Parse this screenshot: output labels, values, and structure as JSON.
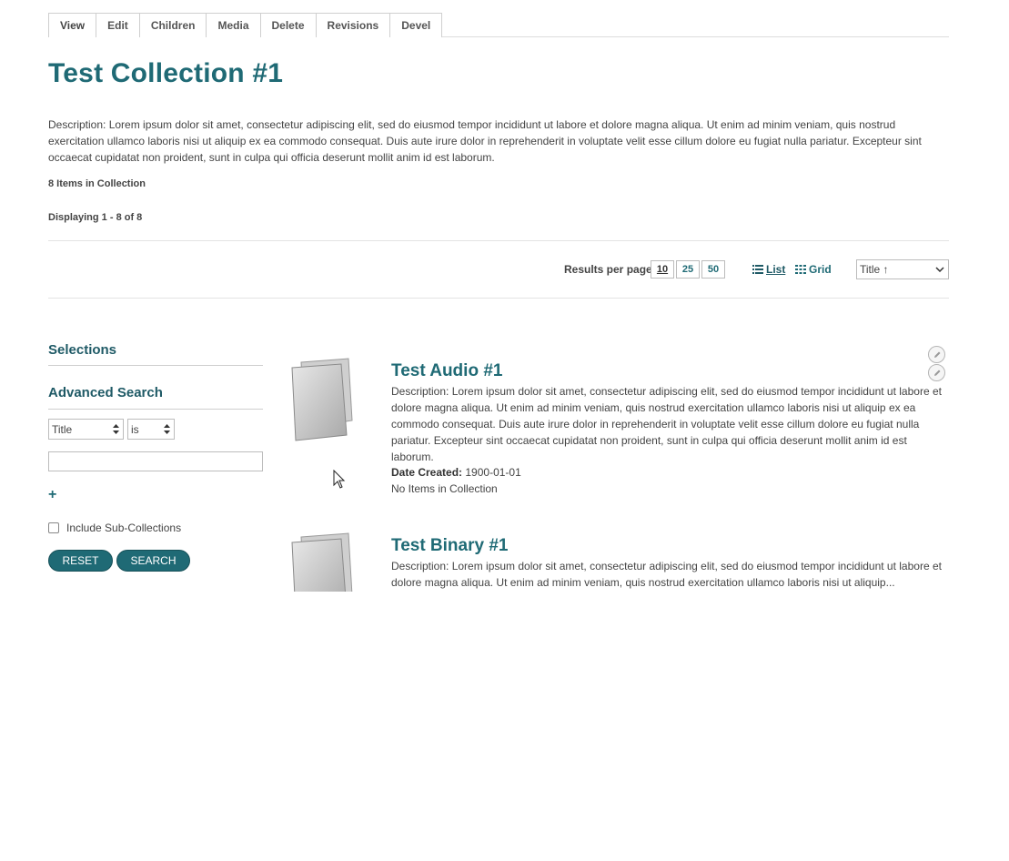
{
  "tabs": [
    {
      "label": "View"
    },
    {
      "label": "Edit"
    },
    {
      "label": "Children"
    },
    {
      "label": "Media"
    },
    {
      "label": "Delete"
    },
    {
      "label": "Revisions"
    },
    {
      "label": "Devel"
    }
  ],
  "collection": {
    "title": "Test Collection #1",
    "description": "Description: Lorem ipsum dolor sit amet, consectetur adipiscing elit, sed do eiusmod tempor incididunt ut labore et dolore magna aliqua. Ut enim ad minim veniam, quis nostrud exercitation ullamco laboris nisi ut aliquip ex ea commodo consequat. Duis aute irure dolor in reprehenderit in voluptate velit esse cillum dolore eu fugiat nulla pariatur. Excepteur sint occaecat cupidatat non proident, sunt in culpa qui officia deserunt mollit anim id est laborum.",
    "item_count": "8 Items in Collection",
    "displaying": "Displaying 1 - 8 of 8"
  },
  "toolbar": {
    "results_per_page_label": "Results per page",
    "rpp_options": [
      "10",
      "25",
      "50"
    ],
    "list_label": "List",
    "grid_label": "Grid",
    "sort_value": "Title ↑"
  },
  "sidebar": {
    "selections_heading": "Selections",
    "advanced_heading": "Advanced Search",
    "field_value": "Title",
    "operator_value": "is",
    "search_value": "",
    "plus_glyph": "+",
    "include_sub": "Include Sub-Collections",
    "reset_label": "Reset",
    "search_label": "Search"
  },
  "results": [
    {
      "title": "Test Audio #1",
      "description": "Description: Lorem ipsum dolor sit amet, consectetur adipiscing elit, sed do eiusmod tempor incididunt ut labore et dolore magna aliqua. Ut enim ad minim veniam, quis nostrud exercitation ullamco laboris nisi ut aliquip ex ea commodo consequat. Duis aute irure dolor in reprehenderit in voluptate velit esse cillum dolore eu fugiat nulla pariatur. Excepteur sint occaecat cupidatat non proident, sunt in culpa qui officia deserunt mollit anim id est laborum.",
      "date_label": "Date Created:",
      "date_value": "1900-01-01",
      "items_label": "No Items in Collection"
    },
    {
      "title": "Test Binary #1",
      "description": "Description: Lorem ipsum dolor sit amet, consectetur adipiscing elit, sed do eiusmod tempor incididunt ut labore et dolore magna aliqua. Ut enim ad minim veniam, quis nostrud exercitation ullamco laboris nisi ut aliquip..."
    }
  ],
  "colors": {
    "accent": "#1f6a75",
    "text": "#444444",
    "border": "#bcbcbc"
  }
}
